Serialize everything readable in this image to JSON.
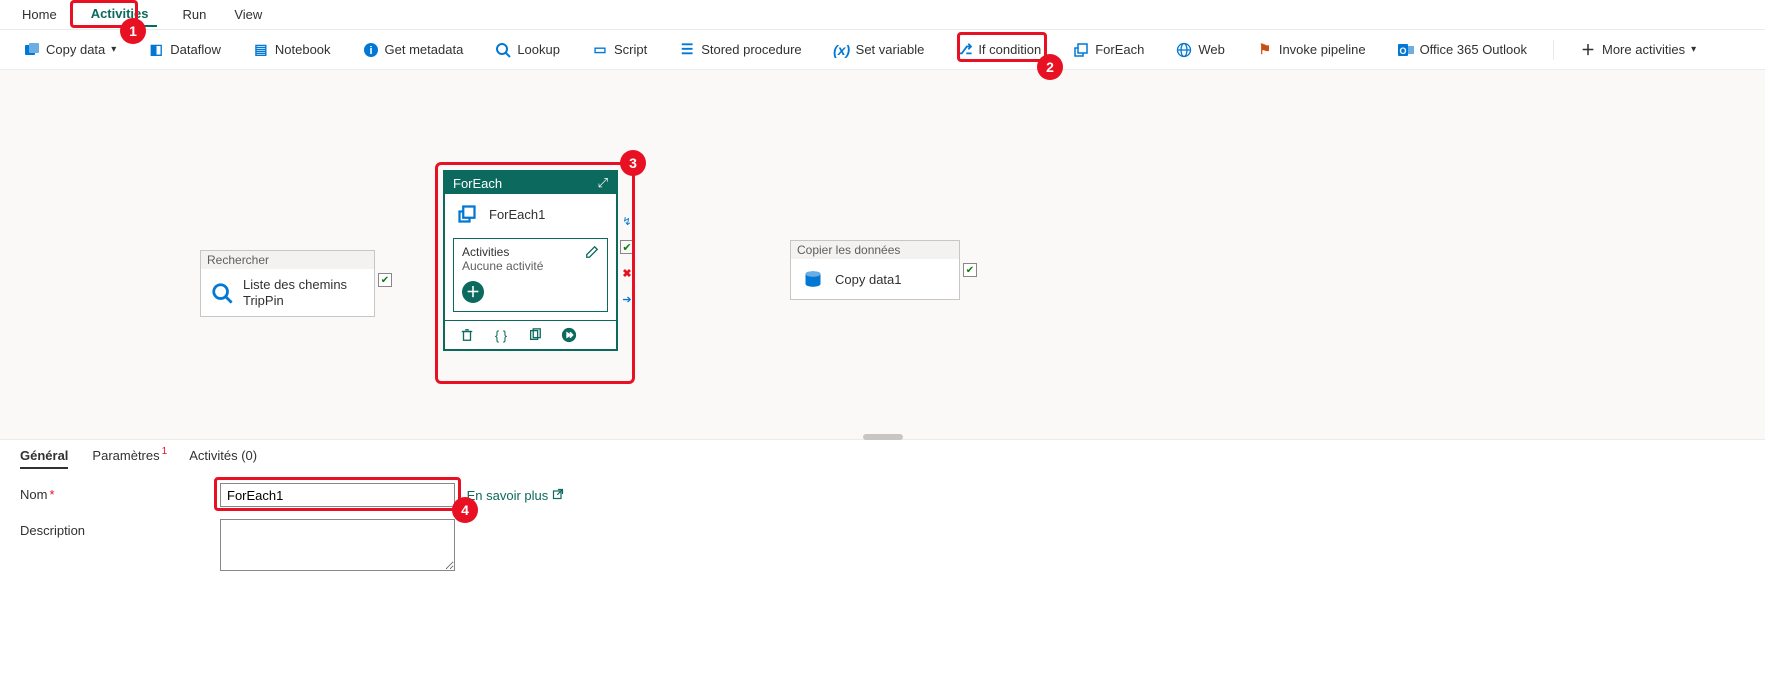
{
  "top_tabs": {
    "home": "Home",
    "activities": "Activities",
    "run": "Run",
    "view": "View"
  },
  "toolbar": {
    "copy_data": "Copy data",
    "dataflow": "Dataflow",
    "notebook": "Notebook",
    "get_metadata": "Get metadata",
    "lookup": "Lookup",
    "script": "Script",
    "stored_proc": "Stored procedure",
    "set_var": "Set variable",
    "if_cond": "If condition",
    "foreach": "ForEach",
    "web": "Web",
    "invoke": "Invoke pipeline",
    "outlook": "Office 365 Outlook",
    "more": "More activities"
  },
  "callouts": {
    "c1": "1",
    "c2": "2",
    "c3": "3",
    "c4": "4"
  },
  "lookup_node": {
    "header": "Rechercher",
    "title": "Liste des chemins TripPin"
  },
  "foreach_node": {
    "head": "ForEach",
    "title": "ForEach1",
    "inner_label": "Activities",
    "inner_sub": "Aucune activité"
  },
  "copy_node": {
    "header": "Copier les données",
    "title": "Copy data1"
  },
  "bottom_tabs": {
    "general": "Général",
    "params": "Paramètres",
    "acts": "Activités (0)"
  },
  "form": {
    "name_label": "Nom",
    "name_value": "ForEach1",
    "learn_more": "En savoir plus",
    "desc_label": "Description"
  }
}
